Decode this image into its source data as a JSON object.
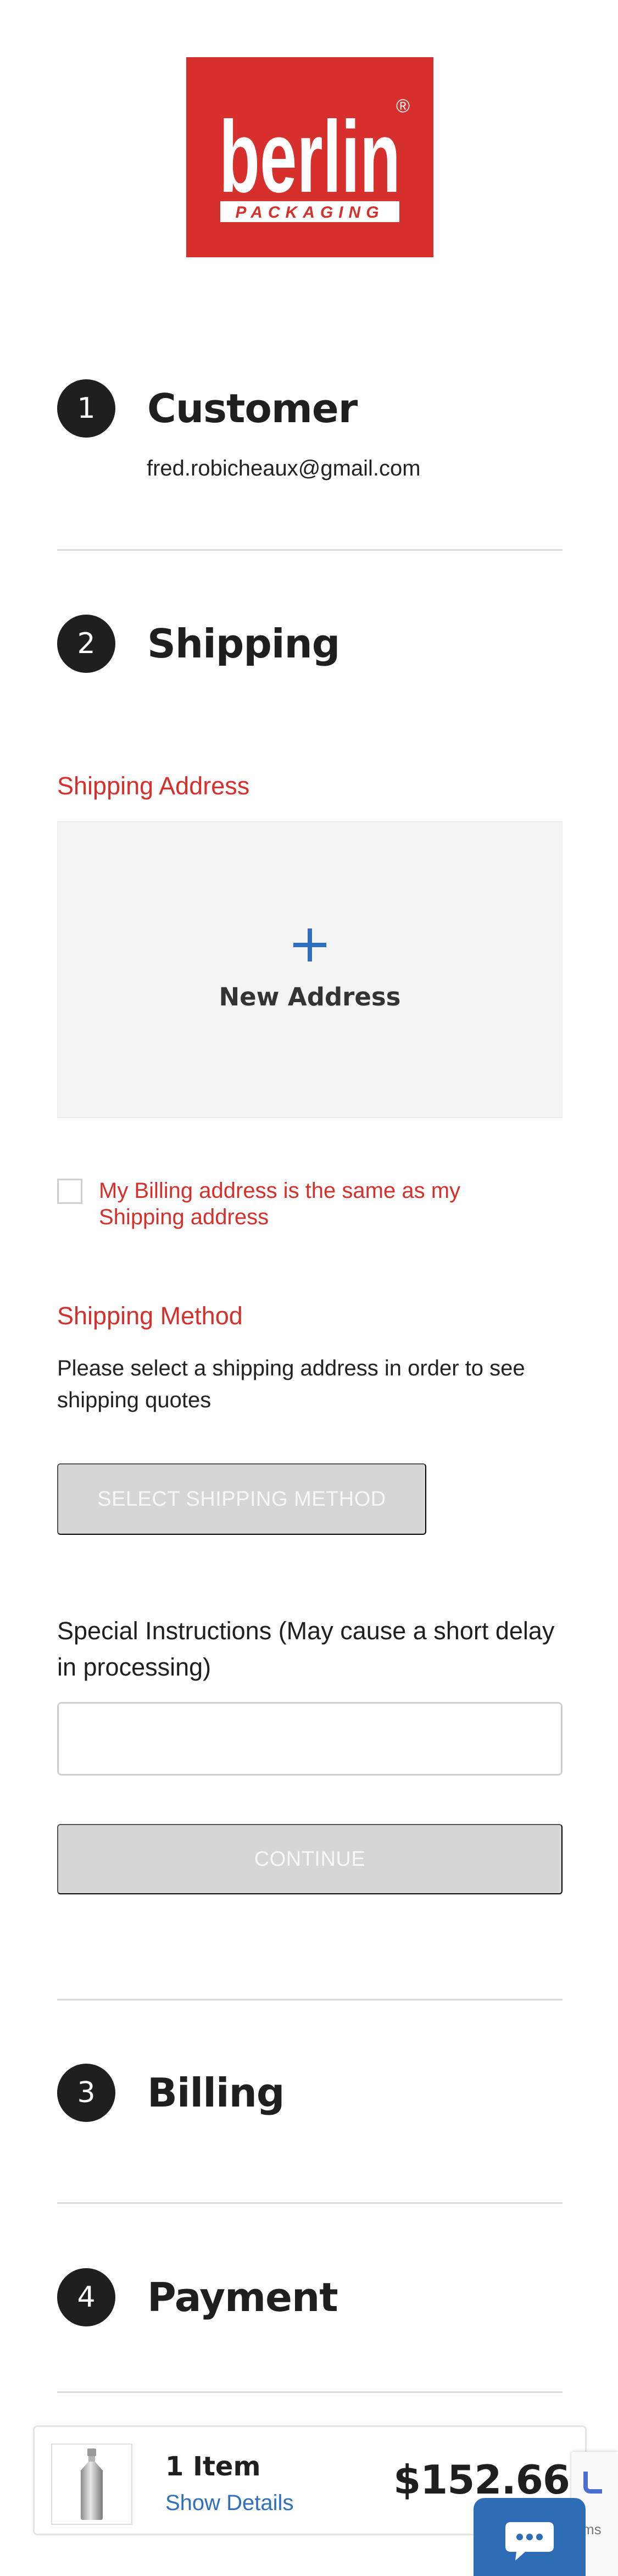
{
  "brand": {
    "name": "berlin",
    "tagline": "PACKAGING",
    "registered_mark": "®",
    "color": "#d7302c"
  },
  "steps": {
    "customer": {
      "number": "1",
      "title": "Customer",
      "email": "fred.robicheaux@gmail.com"
    },
    "shipping": {
      "number": "2",
      "title": "Shipping"
    },
    "billing": {
      "number": "3",
      "title": "Billing"
    },
    "payment": {
      "number": "4",
      "title": "Payment"
    }
  },
  "shipping": {
    "address_label": "Shipping Address",
    "new_address_label": "New Address",
    "new_address_icon": "plus-icon",
    "billing_same_label": "My Billing address is the same as my Shipping address",
    "billing_same_checked": false,
    "method_label": "Shipping Method",
    "method_note": "Please select a shipping address in order to see shipping quotes",
    "select_method_button": "SELECT SHIPPING METHOD",
    "special_instructions_label": "Special Instructions (May cause a short delay in processing)",
    "special_instructions_value": "",
    "continue_button": "CONTINUE"
  },
  "order_summary": {
    "item_count": "1 Item",
    "show_details": "Show Details",
    "total": "$152.66",
    "thumbnail_icon": "bottle-icon"
  },
  "recaptcha": {
    "text": "ms"
  },
  "chat": {
    "icon": "chat-bubble-icon"
  },
  "colors": {
    "accent_red": "#d7302c",
    "link_blue": "#2f6fbf",
    "chat_blue": "#2e6db5",
    "disabled_gray": "#d6d6d6"
  }
}
